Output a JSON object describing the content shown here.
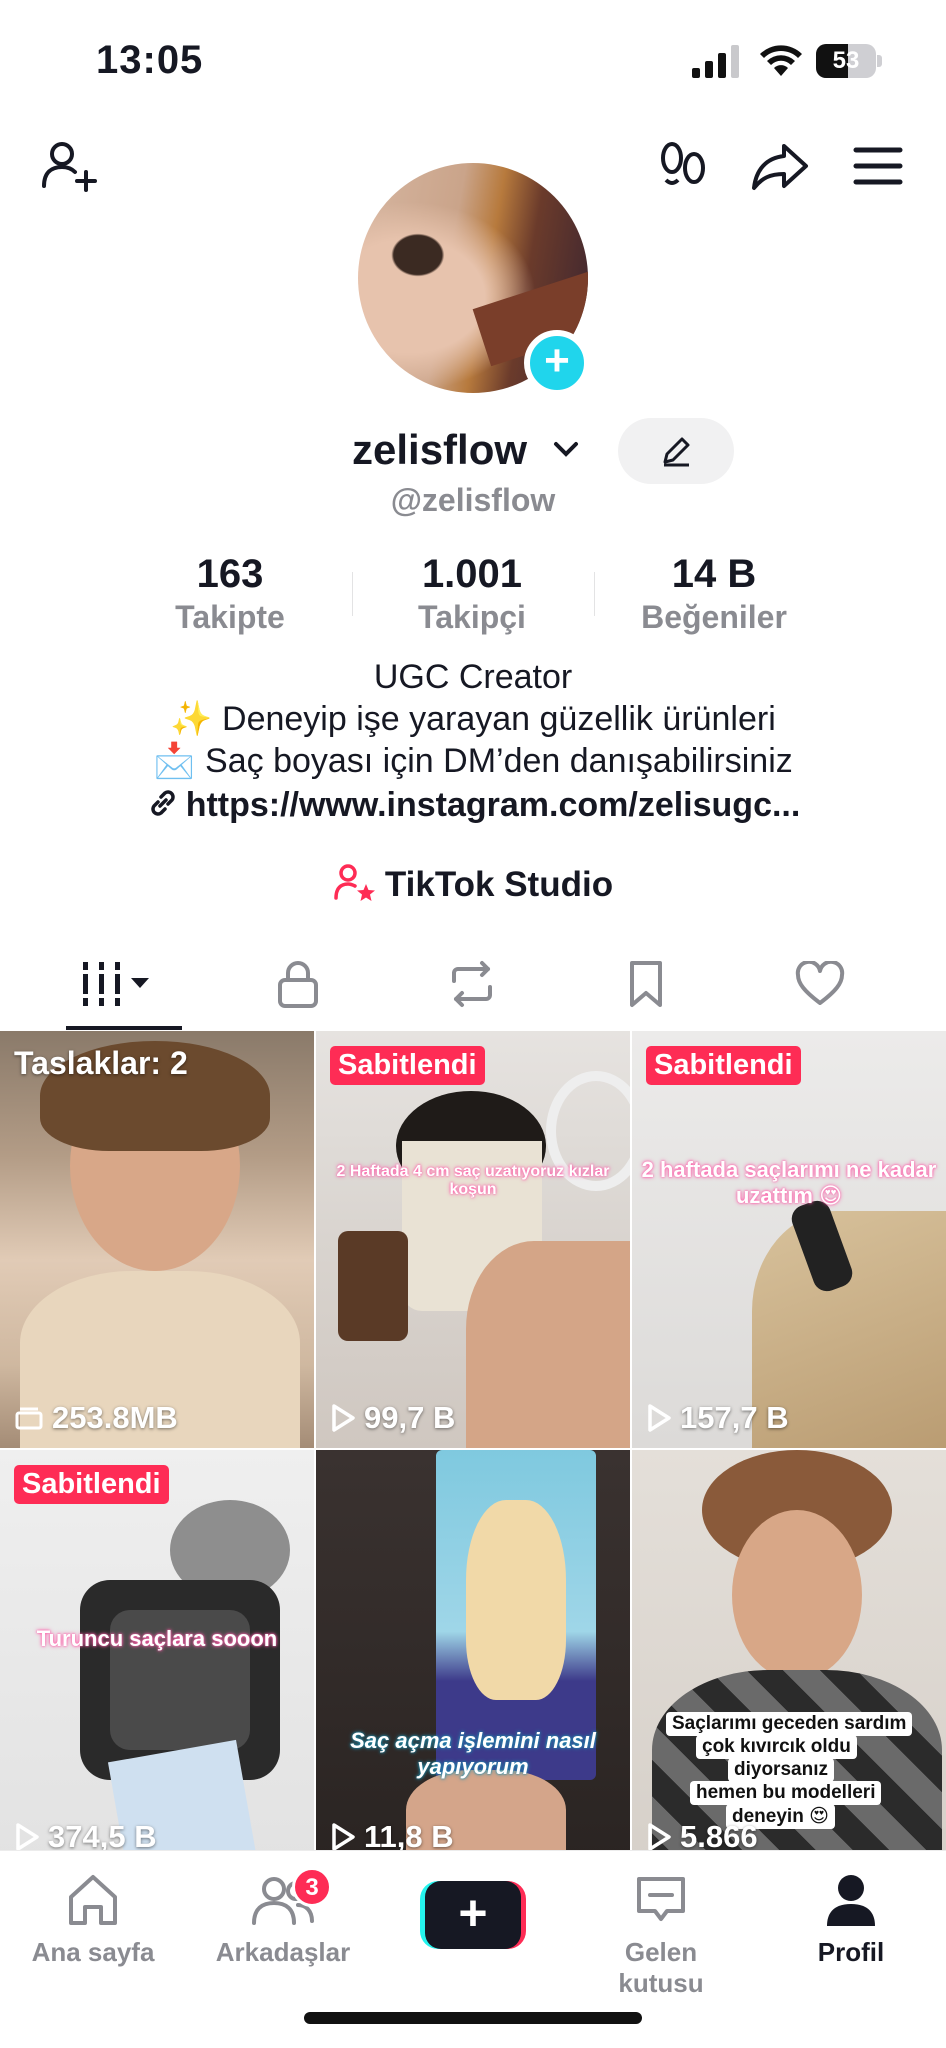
{
  "status": {
    "time": "13:05",
    "battery": "53",
    "battery_level": 0.53
  },
  "profile": {
    "display_name": "zelisflow",
    "handle": "@zelisflow",
    "stats": [
      {
        "value": "163",
        "label": "Takipte"
      },
      {
        "value": "1.001",
        "label": "Takipçi"
      },
      {
        "value": "14 B",
        "label": "Beğeniler"
      }
    ],
    "bio": [
      "UGC Creator",
      "✨ Deneyip işe yarayan güzellik ürünleri",
      "📩 Saç boyası için DM’den danışabilirsiniz"
    ],
    "link": "https://www.instagram.com/zelisugc...",
    "studio_label": "TikTok Studio"
  },
  "colors": {
    "accent": "#fe2c55",
    "cyan": "#20d5ec",
    "text": "#161823",
    "muted": "#8a8b91"
  },
  "tabs": [
    "videos-icon",
    "lock-icon",
    "repost-icon",
    "bookmark-icon",
    "heart-icon"
  ],
  "videos": [
    {
      "kind": "drafts",
      "label": "Taslaklar: 2",
      "stat": "253.8MB",
      "overlay": ""
    },
    {
      "kind": "pinned",
      "label": "Sabitlendi",
      "stat": "99,7 B",
      "overlay": "2 Haftada 4 cm saç uzatıyoruz kızlar koşun"
    },
    {
      "kind": "pinned",
      "label": "Sabitlendi",
      "stat": "157,7 B",
      "overlay": "2 haftada saçlarımı ne kadar uzattım 😍"
    },
    {
      "kind": "pinned",
      "label": "Sabitlendi",
      "stat": "374,5 B",
      "overlay": "Turuncu saçlara sooon"
    },
    {
      "kind": "video",
      "label": "",
      "stat": "11,8 B",
      "overlay": "Saç açma işlemini nasıl yapıyorum"
    },
    {
      "kind": "video",
      "label": "",
      "stat": "5.866",
      "overlay": ""
    }
  ],
  "stickers": [
    "Saçlarımı geceden sardım",
    "çok kıvırcık oldu",
    "diyorsanız",
    "hemen bu modelleri",
    "deneyin 😍"
  ],
  "nav": {
    "home": "Ana sayfa",
    "friends": "Arkadaşlar",
    "friends_badge": "3",
    "inbox": "Gelen kutusu",
    "profile": "Profil"
  }
}
